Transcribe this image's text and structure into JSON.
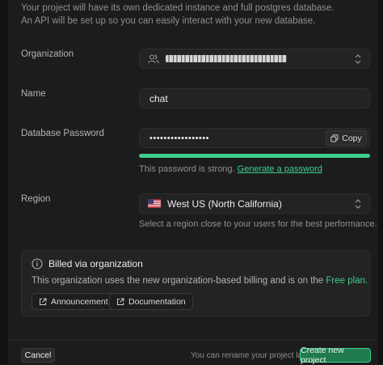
{
  "intro": {
    "line1": "Your project will have its own dedicated instance and full postgres database.",
    "line2": "An API will be set up so you can easily interact with your new database."
  },
  "organization": {
    "label": "Organization",
    "icon": "users-icon"
  },
  "name": {
    "label": "Name",
    "value": "chat"
  },
  "password": {
    "label": "Database Password",
    "masked_value": "•••••••••••••••••",
    "copy_label": "Copy",
    "strength_fraction": 1.0,
    "strength_color": "#3ecf8e",
    "hint_text": "This password is strong.",
    "generate_link": "Generate a password"
  },
  "region": {
    "label": "Region",
    "value": "West US (North California)",
    "flag_icon": "us-flag-icon",
    "hint": "Select a region close to your users for the best performance."
  },
  "billing": {
    "title": "Billed via organization",
    "description": "This organization uses the new organization-based billing and is on the",
    "plan_link": "Free plan.",
    "buttons": {
      "announcement": "Announcement",
      "documentation": "Documentation"
    }
  },
  "footer": {
    "cancel": "Cancel",
    "rename_note": "You can rename your project later",
    "create": "Create new project"
  },
  "colors": {
    "accent": "#3ecf8e",
    "background": "#1c1c1c",
    "surface": "#232323"
  }
}
